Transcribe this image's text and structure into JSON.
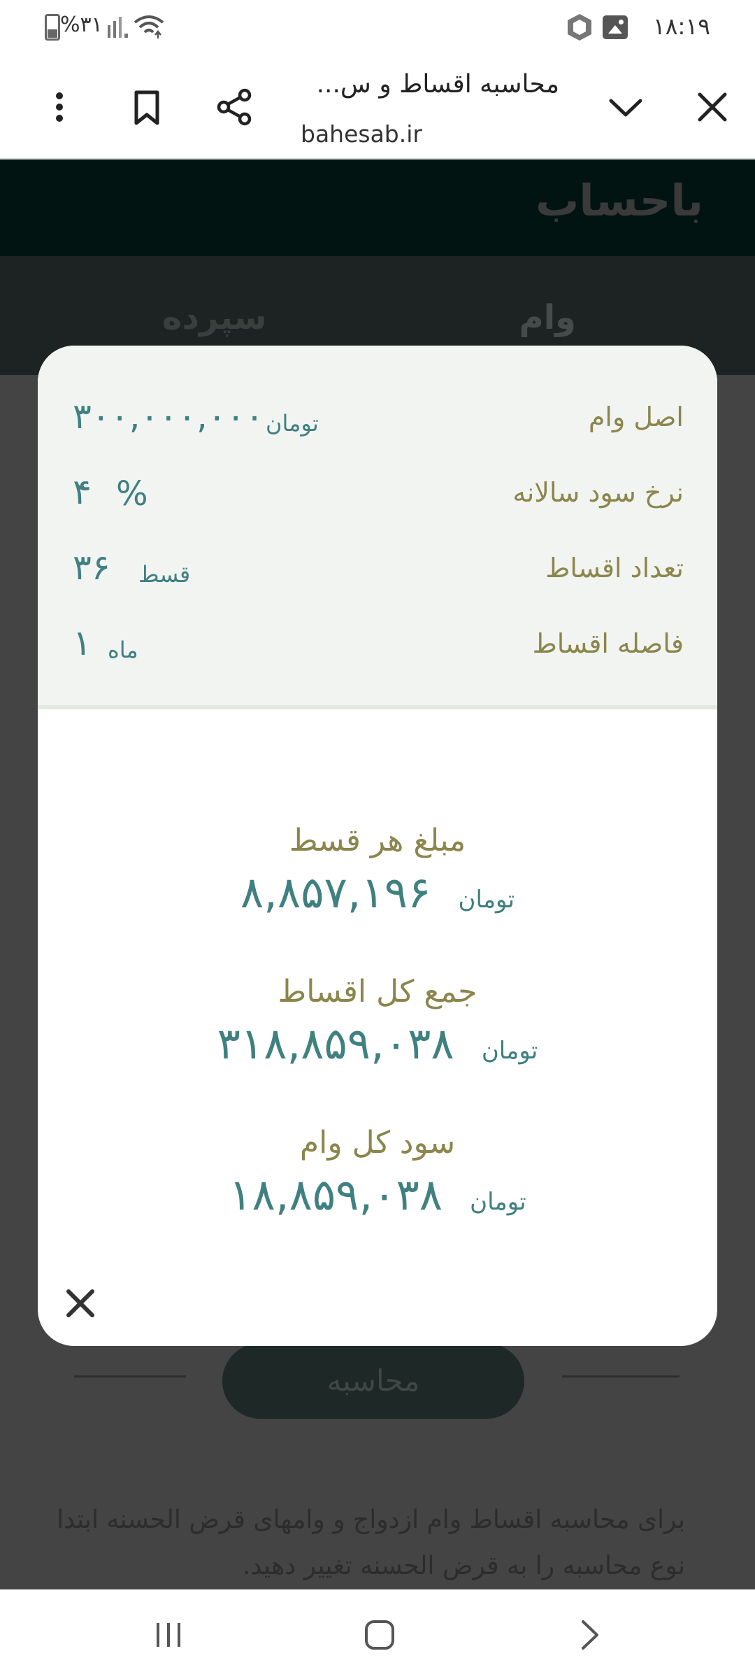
{
  "status_bar": {
    "time": "۱۸:۱۹",
    "battery": "%۳۱",
    "icons": [
      "hexagon-app-icon",
      "gallery-icon",
      "wifi-icon",
      "signal-icon",
      "battery-icon"
    ]
  },
  "browser": {
    "title": "محاسبه اقساط و س...",
    "url": "bahesab.ir",
    "icons": [
      "close-icon",
      "chevron-down-icon",
      "share-icon",
      "bookmark-icon",
      "more-vert-icon"
    ]
  },
  "site": {
    "logo": "باحساب",
    "tabs": [
      "وام",
      "سپرده"
    ],
    "calculate_button": "محاسبه",
    "note": "برای محاسبه اقساط وام ازدواج و وامهای قرض الحسنه ابتدا نوع محاسبه را به قرض الحسنه تغییر دهید."
  },
  "modal": {
    "inputs": [
      {
        "label": "اصل وام",
        "value": "۳۰۰,۰۰۰,۰۰۰",
        "unit": "تومان"
      },
      {
        "label": "نرخ سود سالانه",
        "value": "۴",
        "unit": "%"
      },
      {
        "label": "تعداد اقساط",
        "value": "۳۶",
        "unit": "قسط"
      },
      {
        "label": "فاصله اقساط",
        "value": "۱",
        "unit": "ماه"
      }
    ],
    "results": [
      {
        "label": "مبلغ هر قسط",
        "value": "۸,۸۵۷,۱۹۶",
        "unit": "تومان"
      },
      {
        "label": "جمع کل اقساط",
        "value": "۳۱۸,۸۵۹,۰۳۸",
        "unit": "تومان"
      },
      {
        "label": "سود کل وام",
        "value": "۱۸,۸۵۹,۰۳۸",
        "unit": "تومان"
      }
    ]
  },
  "nav_bar": {
    "icons": [
      "recents-icon",
      "home-icon",
      "back-icon"
    ]
  },
  "colors": {
    "accent_teal": "#3f8081",
    "label_olive": "#8b864c",
    "header_dark": "#021412"
  }
}
